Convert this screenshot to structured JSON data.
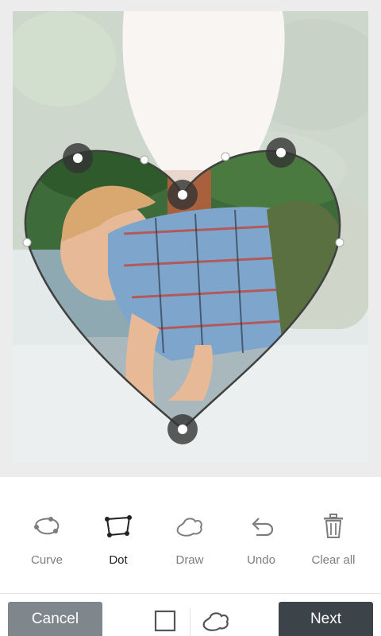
{
  "tools": [
    {
      "label": "Curve",
      "icon": "curve-lasso-icon",
      "active": false
    },
    {
      "label": "Dot",
      "icon": "polygon-dot-icon",
      "active": true
    },
    {
      "label": "Draw",
      "icon": "freehand-draw-icon",
      "active": false
    },
    {
      "label": "Undo",
      "icon": "undo-icon",
      "active": false
    },
    {
      "label": "Clear all",
      "icon": "trash-icon",
      "active": false
    }
  ],
  "bottom": {
    "cancel_label": "Cancel",
    "next_label": "Next",
    "shape_square_icon": "square-shape-icon",
    "shape_freeform_icon": "freeform-shape-icon"
  },
  "colors": {
    "active_tool": "#222222",
    "inactive_tool": "#7d7d7d",
    "cancel_bg": "#7f878c",
    "next_bg": "#3c444a",
    "selection_outline": "#404040"
  }
}
